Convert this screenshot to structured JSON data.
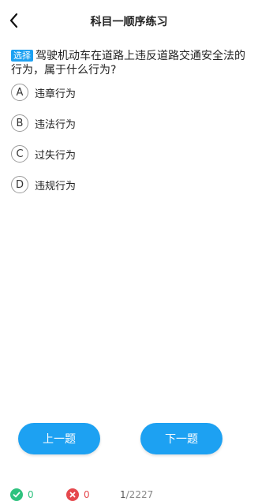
{
  "header": {
    "title": "科目一顺序练习",
    "back_icon": "chevron-left-icon"
  },
  "question": {
    "badge": "选择",
    "text": "驾驶机动车在道路上违反道路交通安全法的行为，属于什么行为?"
  },
  "options": [
    {
      "letter": "A",
      "label": "违章行为"
    },
    {
      "letter": "B",
      "label": "违法行为"
    },
    {
      "letter": "C",
      "label": "过失行为"
    },
    {
      "letter": "D",
      "label": "违规行为"
    }
  ],
  "nav": {
    "prev_label": "上一题",
    "next_label": "下一题"
  },
  "footer": {
    "correct_count": "0",
    "wrong_count": "0",
    "current": "1",
    "total": "/2227"
  },
  "colors": {
    "accent": "#1da1f2",
    "correct": "#2ec27e",
    "wrong": "#e5484d"
  }
}
